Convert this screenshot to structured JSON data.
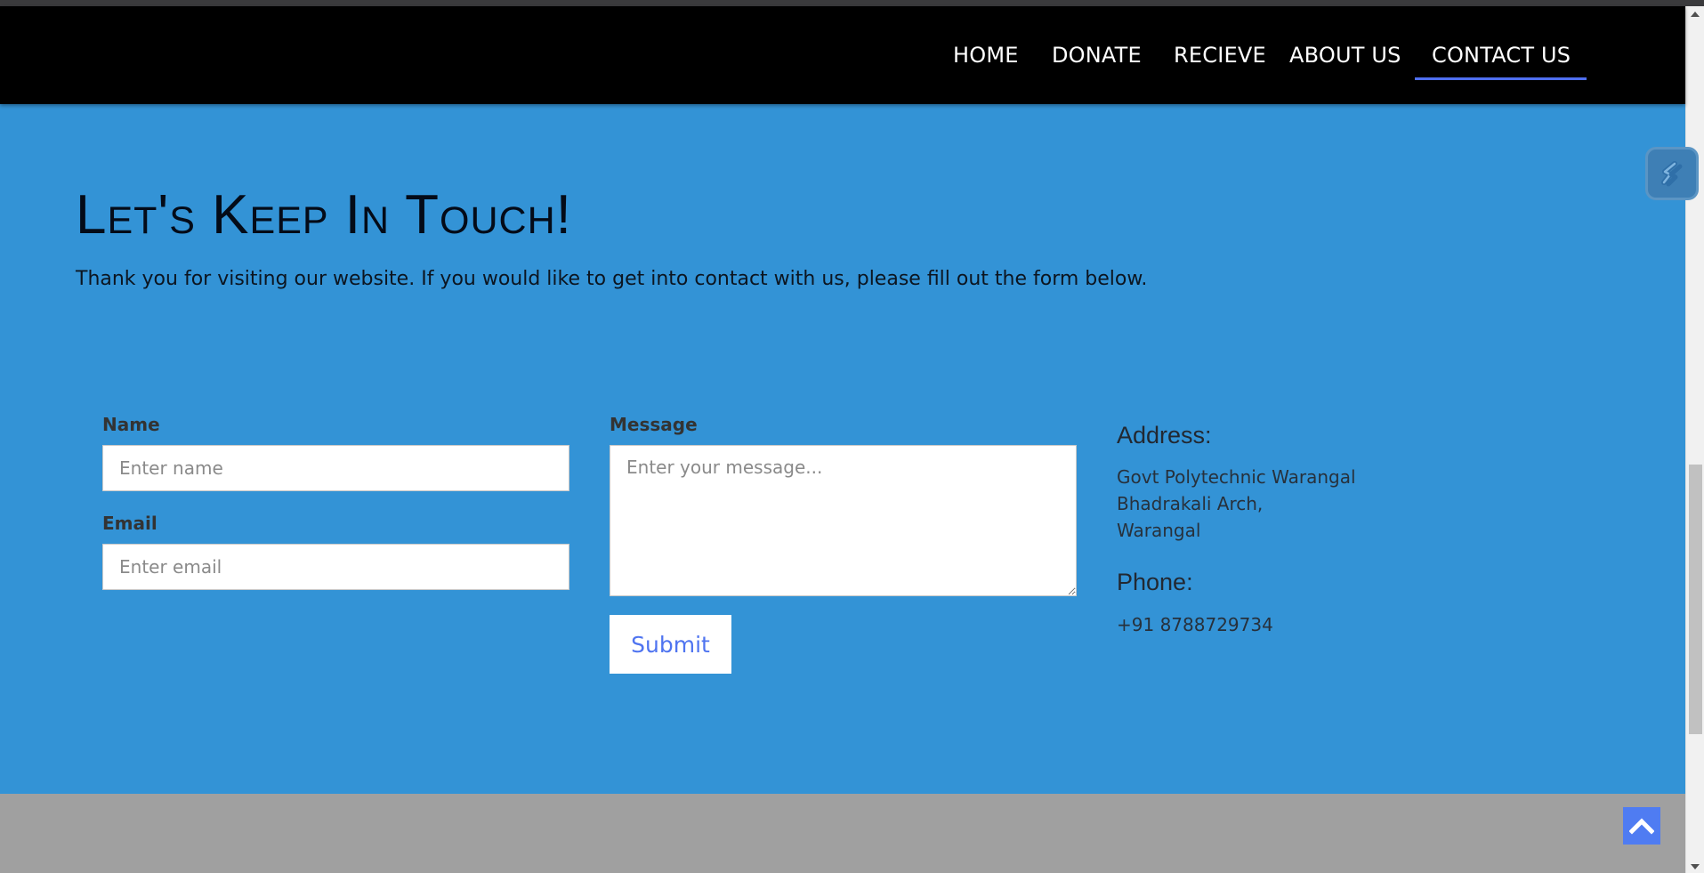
{
  "nav": {
    "items": [
      {
        "label": "HOME"
      },
      {
        "label": "DONATE"
      },
      {
        "label": "RECIEVE"
      },
      {
        "label": "ABOUT US"
      },
      {
        "label": "CONTACT US",
        "active": true
      }
    ]
  },
  "contact": {
    "heading": "Let's Keep In Touch!",
    "intro": "Thank you for visiting our website. If you would like to get into contact with us, please fill out the form below."
  },
  "form": {
    "name_label": "Name",
    "name_placeholder": "Enter name",
    "email_label": "Email",
    "email_placeholder": "Enter email",
    "message_label": "Message",
    "message_placeholder": "Enter your message...",
    "submit_label": "Submit"
  },
  "info": {
    "address_title": "Address:",
    "address_lines": [
      "Govt Polytechnic Warangal",
      "Bhadrakali Arch,",
      "Warangal"
    ],
    "phone_title": "Phone:",
    "phone": "+91 8788729734"
  },
  "icons": {
    "floating_tool": "slash-tool-icon",
    "scroll_top": "chevron-up-icon"
  },
  "colors": {
    "nav_background": "#000000",
    "content_background": "#3393d6",
    "footer_background": "#a0a0a0",
    "accent": "#4f6ff0",
    "submit_text": "#4f74f0"
  }
}
